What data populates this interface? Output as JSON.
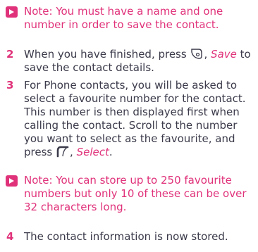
{
  "colors": {
    "accent": "#e0327a",
    "text": "#3a3a4a"
  },
  "note1": {
    "icon": "arrow-box-icon",
    "lines": [
      "Note: You must have a name and one",
      "number in order to save the contact."
    ]
  },
  "step2": {
    "number": "2",
    "line1_before": "When you have finished, press",
    "key_icon": "right-softkey-icon",
    "line1_sep": ",",
    "line1_action": "Save",
    "line1_after": "to",
    "line2": "save the contact details."
  },
  "step3": {
    "number": "3",
    "lines": [
      "For Phone contacts, you will be asked to",
      "select a favourite number for the contact.",
      "This number is then displayed first when",
      "calling the contact. Scroll to the number",
      "you want to select as the favourite, and"
    ],
    "last_before": "press",
    "key_icon": "left-softkey-icon",
    "last_sep": ",",
    "last_action": "Select",
    "last_end": "."
  },
  "note2": {
    "icon": "arrow-box-icon",
    "line1": "Note: You can store up to 250 favourite",
    "lines": [
      "numbers but only 10 of these can be over",
      "32 characters long."
    ]
  },
  "step4": {
    "number": "4",
    "text": "The contact information is now stored."
  }
}
